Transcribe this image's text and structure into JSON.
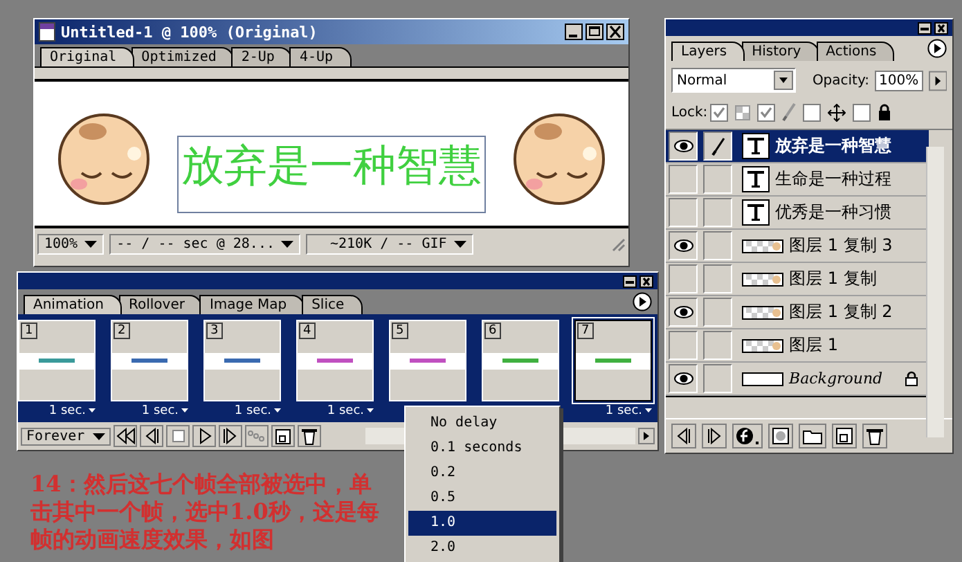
{
  "document_window": {
    "title": "Untitled-1 @ 100% (Original)",
    "tabs": [
      {
        "label": "Original",
        "selected": true
      },
      {
        "label": "Optimized",
        "selected": false
      },
      {
        "label": "2-Up",
        "selected": false
      },
      {
        "label": "4-Up",
        "selected": false
      }
    ],
    "canvas_text": "放弃是一种智慧",
    "status": {
      "zoom": "100%",
      "speed": "-- / -- sec @ 28...",
      "size": "~210K / -- GIF"
    }
  },
  "layers_panel": {
    "tabs": [
      {
        "label": "Layers",
        "selected": true
      },
      {
        "label": "History",
        "selected": false
      },
      {
        "label": "Actions",
        "selected": false
      }
    ],
    "blend_mode": "Normal",
    "opacity_label": "Opacity:",
    "opacity": "100%",
    "lock_label": "Lock:",
    "locks": [
      {
        "checked": true
      },
      {
        "checked": true
      },
      {
        "checked": false
      },
      {
        "checked": false
      }
    ],
    "layers": [
      {
        "name": "放弃是一种智慧",
        "kind": "text",
        "visible": true,
        "selected": true
      },
      {
        "name": "生命是一种过程",
        "kind": "text",
        "visible": false,
        "selected": false
      },
      {
        "name": "优秀是一种习惯",
        "kind": "text",
        "visible": false,
        "selected": false
      },
      {
        "name": "图层 1 复制 3",
        "kind": "image",
        "visible": true,
        "selected": false
      },
      {
        "name": "图层 1 复制",
        "kind": "image",
        "visible": false,
        "selected": false
      },
      {
        "name": "图层 1 复制 2",
        "kind": "image",
        "visible": true,
        "selected": false
      },
      {
        "name": "图层 1",
        "kind": "image",
        "visible": false,
        "selected": false
      },
      {
        "name": "Background",
        "kind": "background",
        "visible": true,
        "selected": false
      }
    ]
  },
  "animation_panel": {
    "tabs": [
      {
        "label": "Animation",
        "selected": true
      },
      {
        "label": "Rollover",
        "selected": false
      },
      {
        "label": "Image Map",
        "selected": false
      },
      {
        "label": "Slice",
        "selected": false
      }
    ],
    "frames": [
      {
        "number": "1",
        "delay": "1 sec.",
        "selected": false,
        "color": "#3a9a9a"
      },
      {
        "number": "2",
        "delay": "1 sec.",
        "selected": false,
        "color": "#3a6ab0"
      },
      {
        "number": "3",
        "delay": "1 sec.",
        "selected": false,
        "color": "#3a6ab0"
      },
      {
        "number": "4",
        "delay": "1 sec.",
        "selected": false,
        "color": "#c050c0"
      },
      {
        "number": "5",
        "selected": false,
        "color": "#c050c0"
      },
      {
        "number": "6",
        "selected": false,
        "color": "#40b040"
      },
      {
        "number": "7",
        "delay": "1 sec.",
        "selected": true,
        "color": "#40b040"
      }
    ],
    "loop": "Forever"
  },
  "delay_menu": {
    "items": [
      {
        "label": "No delay",
        "selected": false
      },
      {
        "label": "0.1 seconds",
        "selected": false
      },
      {
        "label": "0.2",
        "selected": false
      },
      {
        "label": "0.5",
        "selected": false
      },
      {
        "label": "1.0",
        "selected": true
      },
      {
        "label": "2.0",
        "selected": false
      }
    ]
  },
  "annotation": "14：然后这七个帧全部被选中，单击其中一个帧，选中1.0秒，这是每帧的动画速度效果，如图"
}
